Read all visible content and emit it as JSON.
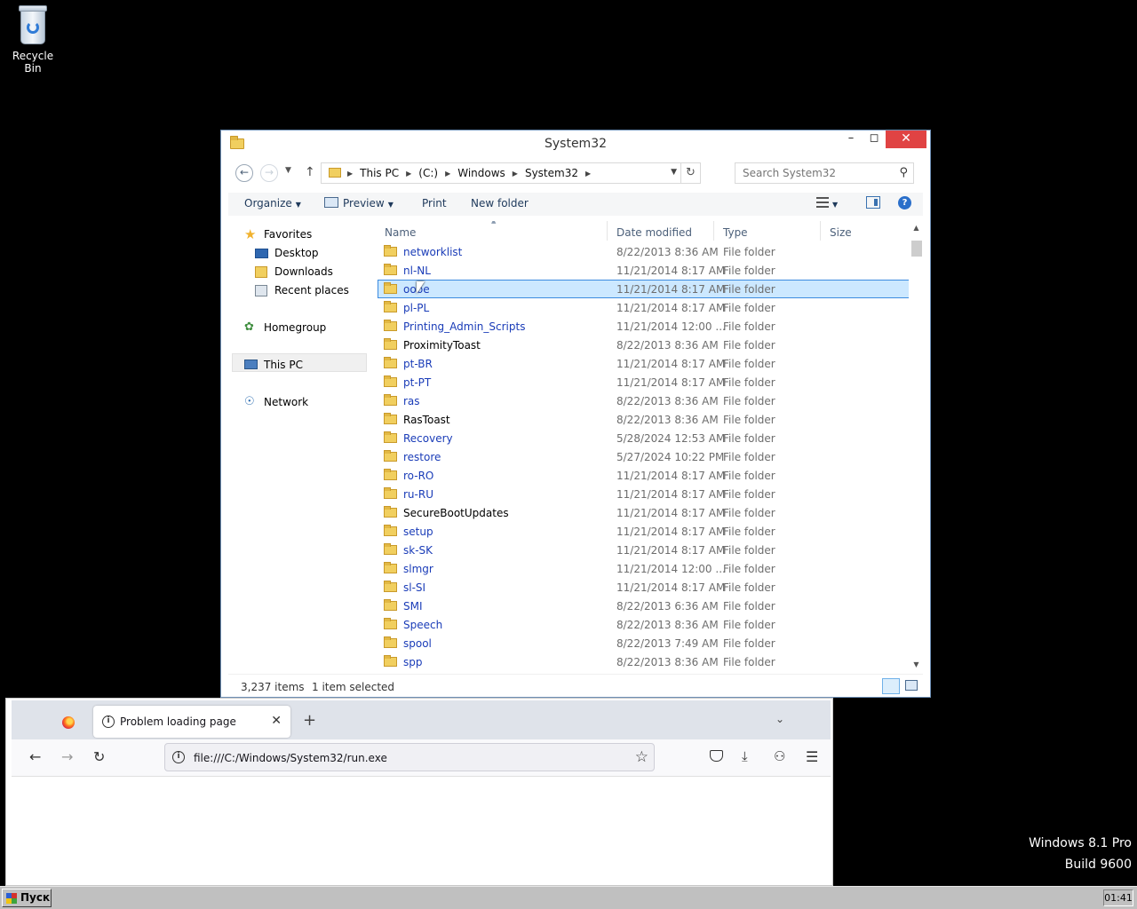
{
  "desktop": {
    "recycle_bin_label": "Recycle Bin",
    "os_name": "Windows 8.1 Pro",
    "build": "Build 9600"
  },
  "explorer": {
    "title": "System32",
    "breadcrumbs": [
      "This PC",
      "(C:)",
      "Windows",
      "System32"
    ],
    "search_placeholder": "Search System32",
    "toolbar": {
      "organize": "Organize",
      "preview": "Preview",
      "print": "Print",
      "new_folder": "New folder"
    },
    "nav": {
      "favorites": "Favorites",
      "desktop": "Desktop",
      "downloads": "Downloads",
      "recent_places": "Recent places",
      "homegroup": "Homegroup",
      "this_pc": "This PC",
      "network": "Network"
    },
    "columns": {
      "name": "Name",
      "date": "Date modified",
      "type": "Type",
      "size": "Size"
    },
    "rows": [
      {
        "name": "networklist",
        "date": "8/22/2013 8:36 AM",
        "type": "File folder",
        "linked": true
      },
      {
        "name": "nl-NL",
        "date": "11/21/2014 8:17 AM",
        "type": "File folder",
        "linked": true
      },
      {
        "name": "oobe",
        "date": "11/21/2014 8:17 AM",
        "type": "File folder",
        "linked": true,
        "selected": true
      },
      {
        "name": "pl-PL",
        "date": "11/21/2014 8:17 AM",
        "type": "File folder",
        "linked": true
      },
      {
        "name": "Printing_Admin_Scripts",
        "date": "11/21/2014 12:00 ...",
        "type": "File folder",
        "linked": true
      },
      {
        "name": "ProximityToast",
        "date": "8/22/2013 8:36 AM",
        "type": "File folder",
        "linked": false
      },
      {
        "name": "pt-BR",
        "date": "11/21/2014 8:17 AM",
        "type": "File folder",
        "linked": true
      },
      {
        "name": "pt-PT",
        "date": "11/21/2014 8:17 AM",
        "type": "File folder",
        "linked": true
      },
      {
        "name": "ras",
        "date": "8/22/2013 8:36 AM",
        "type": "File folder",
        "linked": true
      },
      {
        "name": "RasToast",
        "date": "8/22/2013 8:36 AM",
        "type": "File folder",
        "linked": false
      },
      {
        "name": "Recovery",
        "date": "5/28/2024 12:53 AM",
        "type": "File folder",
        "linked": true
      },
      {
        "name": "restore",
        "date": "5/27/2024 10:22 PM",
        "type": "File folder",
        "linked": true
      },
      {
        "name": "ro-RO",
        "date": "11/21/2014 8:17 AM",
        "type": "File folder",
        "linked": true
      },
      {
        "name": "ru-RU",
        "date": "11/21/2014 8:17 AM",
        "type": "File folder",
        "linked": true
      },
      {
        "name": "SecureBootUpdates",
        "date": "11/21/2014 8:17 AM",
        "type": "File folder",
        "linked": false
      },
      {
        "name": "setup",
        "date": "11/21/2014 8:17 AM",
        "type": "File folder",
        "linked": true
      },
      {
        "name": "sk-SK",
        "date": "11/21/2014 8:17 AM",
        "type": "File folder",
        "linked": true
      },
      {
        "name": "slmgr",
        "date": "11/21/2014 12:00 ...",
        "type": "File folder",
        "linked": true
      },
      {
        "name": "sl-SI",
        "date": "11/21/2014 8:17 AM",
        "type": "File folder",
        "linked": true
      },
      {
        "name": "SMI",
        "date": "8/22/2013 6:36 AM",
        "type": "File folder",
        "linked": true
      },
      {
        "name": "Speech",
        "date": "8/22/2013 8:36 AM",
        "type": "File folder",
        "linked": true
      },
      {
        "name": "spool",
        "date": "8/22/2013 7:49 AM",
        "type": "File folder",
        "linked": true
      },
      {
        "name": "spp",
        "date": "8/22/2013 8:36 AM",
        "type": "File folder",
        "linked": true
      }
    ],
    "status": {
      "items": "3,237 items",
      "selected": "1 item selected"
    }
  },
  "browser": {
    "tab_title": "Problem loading page",
    "url": "file:///C:/Windows/System32/run.exe"
  },
  "taskbar": {
    "start_label": "Пуск",
    "clock": "01:41"
  }
}
